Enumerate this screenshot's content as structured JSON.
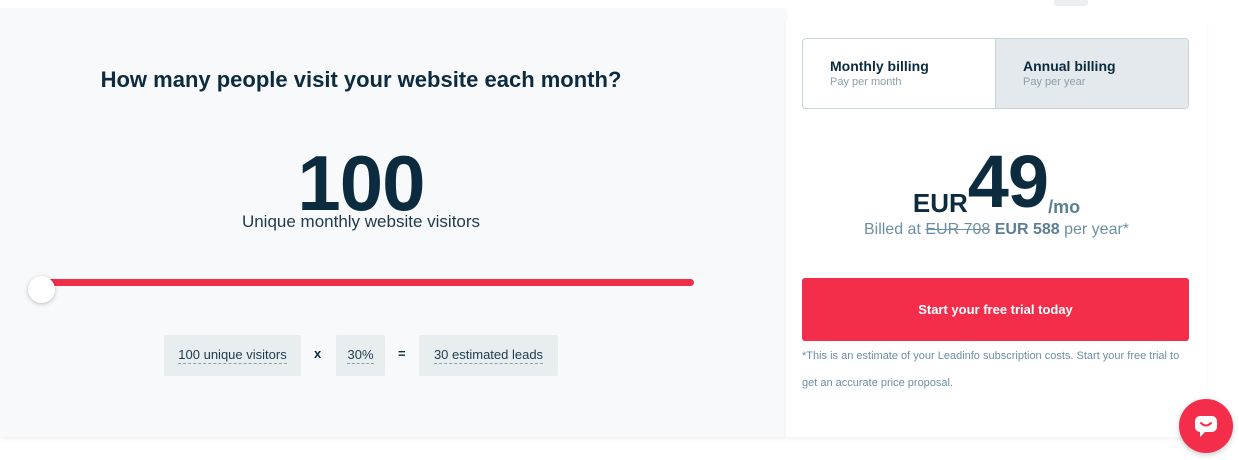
{
  "calculator": {
    "question": "How many people visit your website each month?",
    "visitor_count": "100",
    "visitor_caption": "Unique monthly website visitors",
    "slider_level": 0,
    "formula": {
      "visitors": "100 unique visitors",
      "multiply": "x",
      "rate": "30%",
      "equals": "=",
      "leads": "30 estimated leads"
    }
  },
  "billing": {
    "monthly": {
      "title": "Monthly billing",
      "subtitle": "Pay per month"
    },
    "annual": {
      "title": "Annual billing",
      "subtitle": "Pay per year"
    },
    "selected": "annual"
  },
  "pricing": {
    "currency": "EUR",
    "amount": "49",
    "period": "/mo",
    "billed_prefix": "Billed at",
    "old_price": "EUR 708",
    "new_price": "EUR 588",
    "billed_suffix": "per year*"
  },
  "cta_label": "Start your free trial today",
  "disclaimer": "*This is an estimate of your Leadinfo subscription costs. Start your free trial to get an accurate price proposal.",
  "icons": {
    "chat": "chat-icon"
  },
  "colors": {
    "accent": "#f42d4a",
    "text": "#0d2b3e",
    "muted": "#6b8fa3"
  }
}
